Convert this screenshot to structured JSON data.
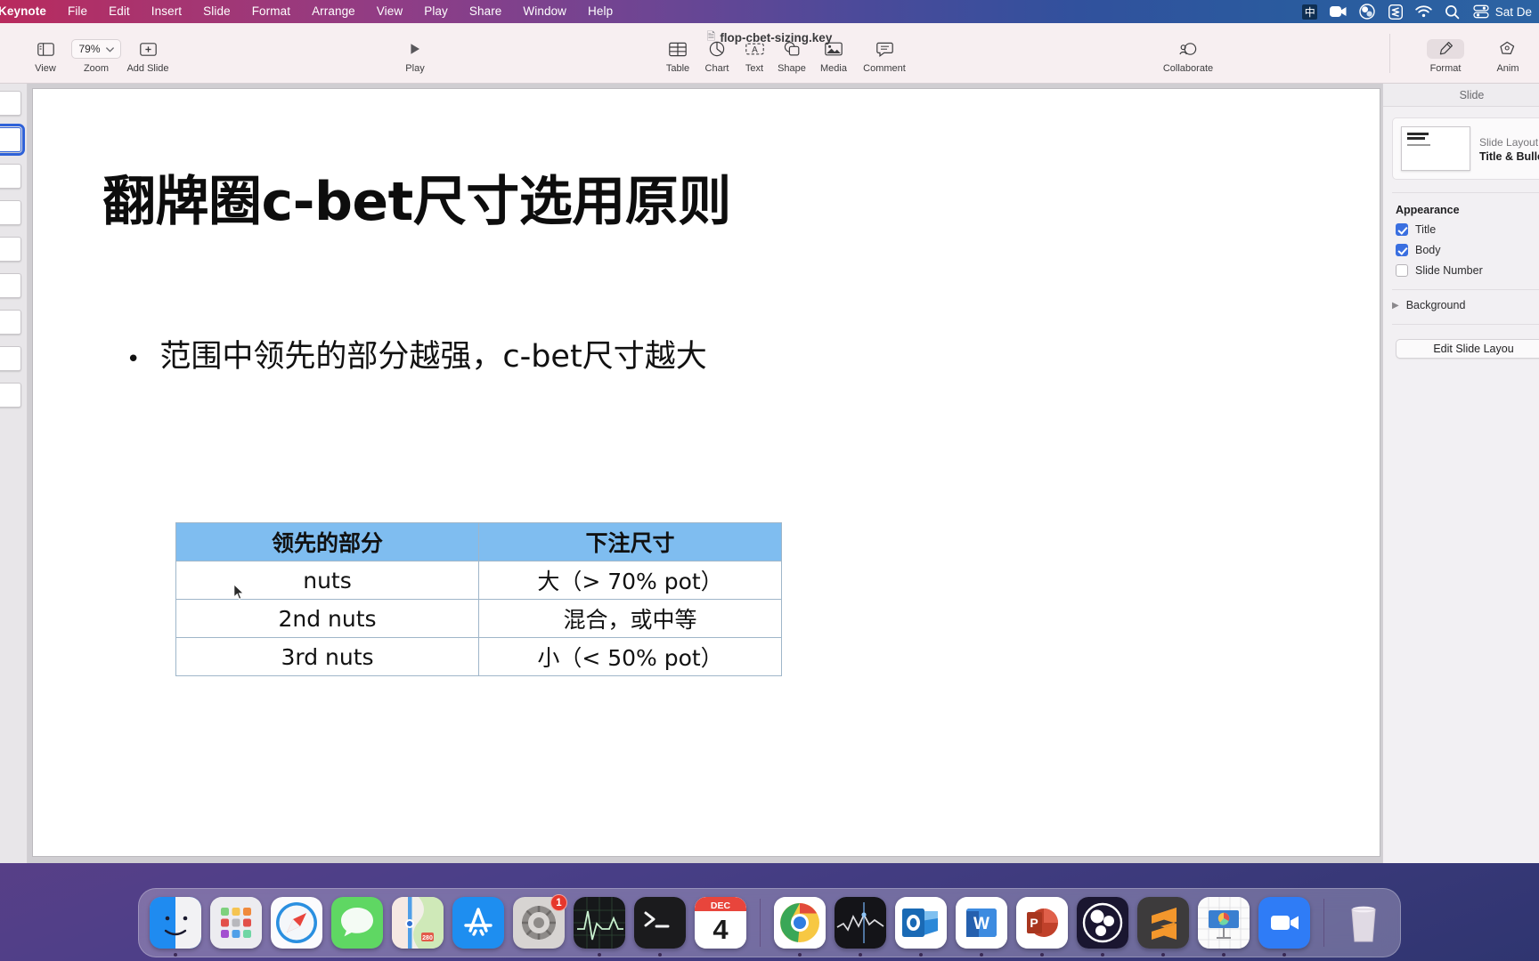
{
  "menubar": {
    "app_name": "Keynote",
    "items": [
      "File",
      "Edit",
      "Insert",
      "Slide",
      "Format",
      "Arrange",
      "View",
      "Play",
      "Share",
      "Window",
      "Help"
    ],
    "status_icons": [
      {
        "name": "input-source-icon",
        "glyph": "中"
      },
      {
        "name": "screen-recording-icon",
        "glyph": "■"
      },
      {
        "name": "obs-icon",
        "glyph": "●"
      },
      {
        "name": "sublime-text-icon",
        "glyph": "S"
      },
      {
        "name": "wifi-icon",
        "glyph": "◠"
      },
      {
        "name": "spotlight-search-icon",
        "glyph": "⚲"
      },
      {
        "name": "control-center-icon",
        "glyph": "≡"
      }
    ],
    "clock": "Sat De"
  },
  "toolbar": {
    "document_title": "flop-cbet-sizing.key",
    "view_label": "View",
    "zoom_label": "Zoom",
    "zoom_value": "79%",
    "add_slide_label": "Add Slide",
    "play_label": "Play",
    "table_label": "Table",
    "chart_label": "Chart",
    "text_label": "Text",
    "shape_label": "Shape",
    "media_label": "Media",
    "comment_label": "Comment",
    "collaborate_label": "Collaborate",
    "format_label": "Format",
    "animate_label": "Anim"
  },
  "navigator": {
    "slides": [
      {
        "index": 1,
        "selected": false,
        "has_image": false
      },
      {
        "index": 2,
        "selected": true,
        "has_image": false
      },
      {
        "index": 3,
        "selected": false,
        "has_image": false
      },
      {
        "index": 4,
        "selected": false,
        "has_image": false
      },
      {
        "index": 5,
        "selected": false,
        "has_image": false
      },
      {
        "index": 6,
        "selected": false,
        "has_image": false
      },
      {
        "index": 7,
        "selected": false,
        "has_image": false
      },
      {
        "index": 8,
        "selected": false,
        "has_image": true
      },
      {
        "index": 9,
        "selected": false,
        "has_image": false
      }
    ]
  },
  "slide": {
    "title": "翻牌圈c-bet尺寸选用原则",
    "bullet_marker": "•",
    "bullet_text": "范围中领先的部分越强，c-bet尺寸越大",
    "table": {
      "headers": [
        "领先的部分",
        "下注尺寸"
      ],
      "rows": [
        [
          "nuts",
          "大（> 70% pot）"
        ],
        [
          "2nd nuts",
          "混合，或中等"
        ],
        [
          "3rd nuts",
          "小（< 50% pot）"
        ]
      ],
      "header_bg": "#7fbdf0",
      "border_color": "#9fb6c9"
    }
  },
  "inspector": {
    "tab_label": "Slide",
    "slide_layout_label": "Slide Layout",
    "slide_layout_value": "Title & Bulle",
    "appearance_title": "Appearance",
    "checkboxes": [
      {
        "label": "Title",
        "checked": true
      },
      {
        "label": "Body",
        "checked": true
      },
      {
        "label": "Slide Number",
        "checked": false
      }
    ],
    "background_label": "Background",
    "edit_layout_button": "Edit Slide Layou",
    "accent_color": "#3a6fe0"
  },
  "dock": {
    "items": [
      {
        "name": "finder",
        "label": "Finder",
        "running": true,
        "badge": null
      },
      {
        "name": "launchpad",
        "label": "Launchpad",
        "running": false,
        "badge": null
      },
      {
        "name": "safari",
        "label": "Safari",
        "running": false,
        "badge": null
      },
      {
        "name": "messages",
        "label": "Messages",
        "running": false,
        "badge": null
      },
      {
        "name": "maps",
        "label": "Maps",
        "running": false,
        "badge": null
      },
      {
        "name": "app-store",
        "label": "App Store",
        "running": false,
        "badge": null
      },
      {
        "name": "system-settings",
        "label": "System Settings",
        "running": false,
        "badge": "1"
      },
      {
        "name": "activity-monitor",
        "label": "Activity Monitor",
        "running": true,
        "badge": null
      },
      {
        "name": "terminal",
        "label": "Terminal",
        "running": true,
        "badge": null
      },
      {
        "name": "calendar",
        "label": "Calendar",
        "running": false,
        "badge": null,
        "month": "DEC",
        "day": "4"
      },
      {
        "separator": true
      },
      {
        "name": "google-chrome",
        "label": "Google Chrome",
        "running": true,
        "badge": null
      },
      {
        "name": "stocks",
        "label": "Stocks",
        "running": true,
        "badge": null
      },
      {
        "name": "outlook",
        "label": "Outlook",
        "running": true,
        "badge": null
      },
      {
        "name": "word",
        "label": "Word",
        "running": true,
        "badge": null
      },
      {
        "name": "powerpoint",
        "label": "PowerPoint",
        "running": true,
        "badge": null
      },
      {
        "name": "obs-studio",
        "label": "OBS Studio",
        "running": true,
        "badge": null
      },
      {
        "name": "sublime-text",
        "label": "Sublime Text",
        "running": true,
        "badge": null
      },
      {
        "name": "keynote",
        "label": "Keynote",
        "running": true,
        "badge": null
      },
      {
        "name": "zoom",
        "label": "Zoom",
        "running": true,
        "badge": null
      },
      {
        "separator": true
      },
      {
        "name": "trash",
        "label": "Trash",
        "running": false,
        "badge": null
      }
    ]
  }
}
